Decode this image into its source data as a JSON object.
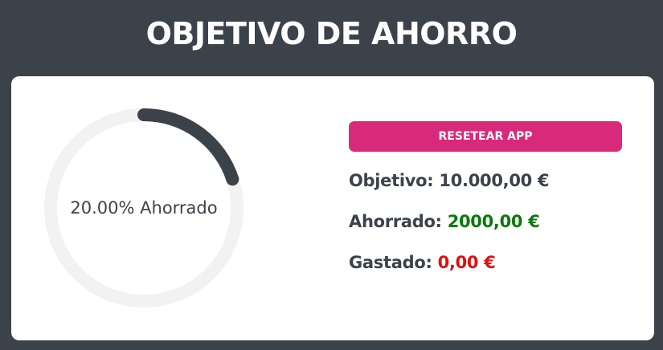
{
  "header": {
    "title": "OBJETIVO DE AHORRO"
  },
  "gauge": {
    "label": "20.00% Ahorrado",
    "progress_percent": 20,
    "track_color": "#f2f2f2",
    "fill_color": "#3c424a"
  },
  "actions": {
    "reset_label": "RESETEAR APP"
  },
  "stats": {
    "goal_label": "Objetivo:",
    "goal_value": "10.000,00 €",
    "saved_label": "Ahorrado:",
    "saved_value": "2000,00 €",
    "spent_label": "Gastado:",
    "spent_value": "0,00 €"
  },
  "colors": {
    "background": "#3c424a",
    "accent": "#d9297a",
    "saved": "#0a7a0a",
    "spent": "#e01010"
  }
}
